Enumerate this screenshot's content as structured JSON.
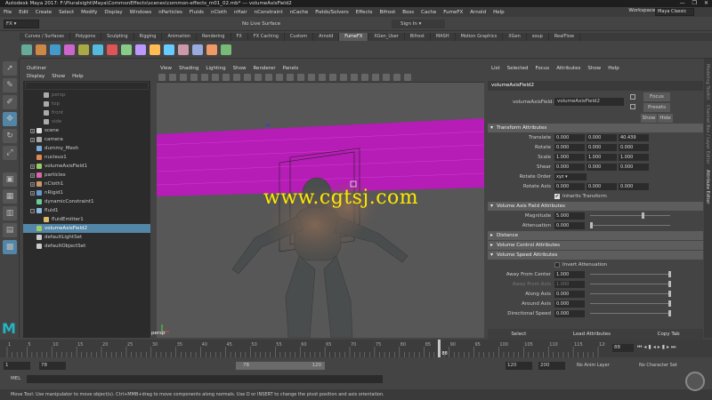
{
  "window": {
    "title": "Autodesk Maya 2017: F:\\Pluralsight\\Maya\\CommonEffects\\scenes\\common-effects_m01_02.mb*   ---   volumeAxisField2",
    "controls": [
      "—",
      "❐",
      "✕"
    ]
  },
  "menubar": {
    "items": [
      "File",
      "Edit",
      "Create",
      "Select",
      "Modify",
      "Display",
      "Windows",
      "nParticles",
      "Fluids",
      "nCloth",
      "nHair",
      "nConstraint",
      "nCache",
      "Fields/Solvers",
      "Effects",
      "Bifrost",
      "Boss",
      "Cache",
      "FumeFX",
      "Arnold",
      "Help"
    ],
    "workspace_label": "Workspace :",
    "workspace_value": "Maya Classic"
  },
  "statusline": {
    "mode": "FX",
    "live_surface": "No Live Surface",
    "sign_in": "Sign In"
  },
  "shelf": {
    "tabs": [
      "Curves / Surfaces",
      "Polygons",
      "Sculpting",
      "Rigging",
      "Animation",
      "Rendering",
      "FX",
      "FX Caching",
      "Custom",
      "Arnold",
      "FumeFX",
      "XGen_User",
      "Bifrost",
      "MASH",
      "Motion Graphics",
      "XGen",
      "soup",
      "RealFlow"
    ],
    "active_tab": "FumeFX"
  },
  "outliner": {
    "title": "Outliner",
    "menu": [
      "Display",
      "Show",
      "Help"
    ],
    "items": [
      {
        "label": "persp",
        "state": "dim",
        "indent": 2,
        "icon": "camera-icon"
      },
      {
        "label": "top",
        "state": "dim",
        "indent": 2,
        "icon": "camera-icon"
      },
      {
        "label": "front",
        "state": "dim",
        "indent": 2,
        "icon": "camera-icon"
      },
      {
        "label": "side",
        "state": "dim",
        "indent": 2,
        "icon": "camera-icon"
      },
      {
        "label": "scene",
        "state": "normal",
        "indent": 1,
        "icon": "group-icon",
        "expand": "+"
      },
      {
        "label": "camera",
        "state": "normal",
        "indent": 1,
        "icon": "camera-icon",
        "expand": "+"
      },
      {
        "label": "dummy_Mesh",
        "state": "normal",
        "indent": 1,
        "icon": "mesh-icon"
      },
      {
        "label": "nucleus1",
        "state": "normal",
        "indent": 1,
        "icon": "nucleus-icon"
      },
      {
        "label": "volumeAxisField1",
        "state": "normal",
        "indent": 1,
        "icon": "field-icon",
        "expand": "+"
      },
      {
        "label": "particles",
        "state": "normal",
        "indent": 1,
        "icon": "particle-icon",
        "expand": "+"
      },
      {
        "label": "nCloth1",
        "state": "normal",
        "indent": 1,
        "icon": "ncloth-icon",
        "expand": "+"
      },
      {
        "label": "nRigid1",
        "state": "normal",
        "indent": 1,
        "icon": "nrigid-icon",
        "expand": "+"
      },
      {
        "label": "dynamicConstraint1",
        "state": "normal",
        "indent": 1,
        "icon": "constraint-icon"
      },
      {
        "label": "fluid1",
        "state": "normal",
        "indent": 1,
        "icon": "fluid-icon",
        "expand": "−"
      },
      {
        "label": "fluidEmitter1",
        "state": "normal",
        "indent": 2,
        "icon": "emitter-icon"
      },
      {
        "label": "volumeAxisField2",
        "state": "selected",
        "indent": 1,
        "icon": "field-icon"
      },
      {
        "label": "defaultLightSet",
        "state": "normal",
        "indent": 1,
        "icon": "set-icon"
      },
      {
        "label": "defaultObjectSet",
        "state": "normal",
        "indent": 1,
        "icon": "set-icon"
      }
    ]
  },
  "viewport": {
    "menu": [
      "View",
      "Shading",
      "Lighting",
      "Show",
      "Renderer",
      "Panels"
    ],
    "camera_label": "persp",
    "watermark": "www.cgtsj.com"
  },
  "attribute_editor": {
    "menu": [
      "List",
      "Selected",
      "Focus",
      "Attributes",
      "Show",
      "Help"
    ],
    "tab_name": "volumeAxisField2",
    "node_label": "volumeAxisField:",
    "node_value": "volumeAxisField2",
    "buttons": {
      "focus": "Focus",
      "presets": "Presets",
      "show": "Show",
      "hide": "Hide"
    },
    "transform_section": "Transform Attributes",
    "transform": [
      {
        "label": "Translate",
        "values": [
          "0.000",
          "0.000",
          "40.439"
        ]
      },
      {
        "label": "Rotate",
        "values": [
          "0.000",
          "0.000",
          "0.000"
        ]
      },
      {
        "label": "Scale",
        "values": [
          "1.000",
          "1.000",
          "1.000"
        ]
      },
      {
        "label": "Shear",
        "values": [
          "0.000",
          "0.000",
          "0.000"
        ]
      }
    ],
    "rotate_order_label": "Rotate Order",
    "rotate_order_value": "xyz",
    "rotate_axis_label": "Rotate Axis",
    "rotate_axis_values": [
      "0.000",
      "0.000",
      "0.000"
    ],
    "inherits_transform": "Inherits Transform",
    "field_section": "Volume Axis Field Attributes",
    "magnitude_label": "Magnitude",
    "magnitude_value": "5.000",
    "attenuation_label": "Attenuation",
    "attenuation_value": "0.000",
    "distance_section": "Distance",
    "volume_control_section": "Volume Control Attributes",
    "volume_speed_section": "Volume Speed Attributes",
    "invert_attenuation": "Invert Attenuation",
    "speed_rows": [
      {
        "label": "Away From Center",
        "value": "1.000",
        "dim": false
      },
      {
        "label": "Away From Axis",
        "value": "1.000",
        "dim": true
      },
      {
        "label": "Along Axis",
        "value": "0.000",
        "dim": false
      },
      {
        "label": "Around Axis",
        "value": "0.000",
        "dim": false
      },
      {
        "label": "Directional Speed",
        "value": "0.000",
        "dim": false
      }
    ],
    "footer": [
      "Select",
      "Load Attributes",
      "Copy Tab"
    ]
  },
  "side_tabs": [
    "Modeling Toolkit",
    "Channel Box / Layer Editor",
    "Attribute Editor"
  ],
  "timeslider": {
    "ticks": [
      "1",
      "5",
      "10",
      "15",
      "20",
      "25",
      "30",
      "35",
      "40",
      "45",
      "50",
      "55",
      "60",
      "65",
      "70",
      "75",
      "80",
      "85",
      "90",
      "95",
      "100",
      "105",
      "110",
      "115",
      "120"
    ],
    "current_frame": "88",
    "current_frame_field": "88"
  },
  "rangeslider": {
    "start": "1",
    "anim_start": "78",
    "range_start": "78",
    "range_end": "120",
    "end": "120",
    "anim_end": "200",
    "anim_layer": "No Anim Layer",
    "char_set": "No Character Set"
  },
  "cmdline": {
    "label": "MEL"
  },
  "helpline": {
    "text": "Move Tool: Use manipulator to move object(s). Ctrl+MMB+drag to move components along normals. Use D or INSERT to change the pivot position and axis orientation."
  },
  "colors": {
    "selection": "#5285a6",
    "grid_magenta": "#c21ac2",
    "watermark": "#ffe600",
    "maya_logo": "#23b5c3"
  }
}
